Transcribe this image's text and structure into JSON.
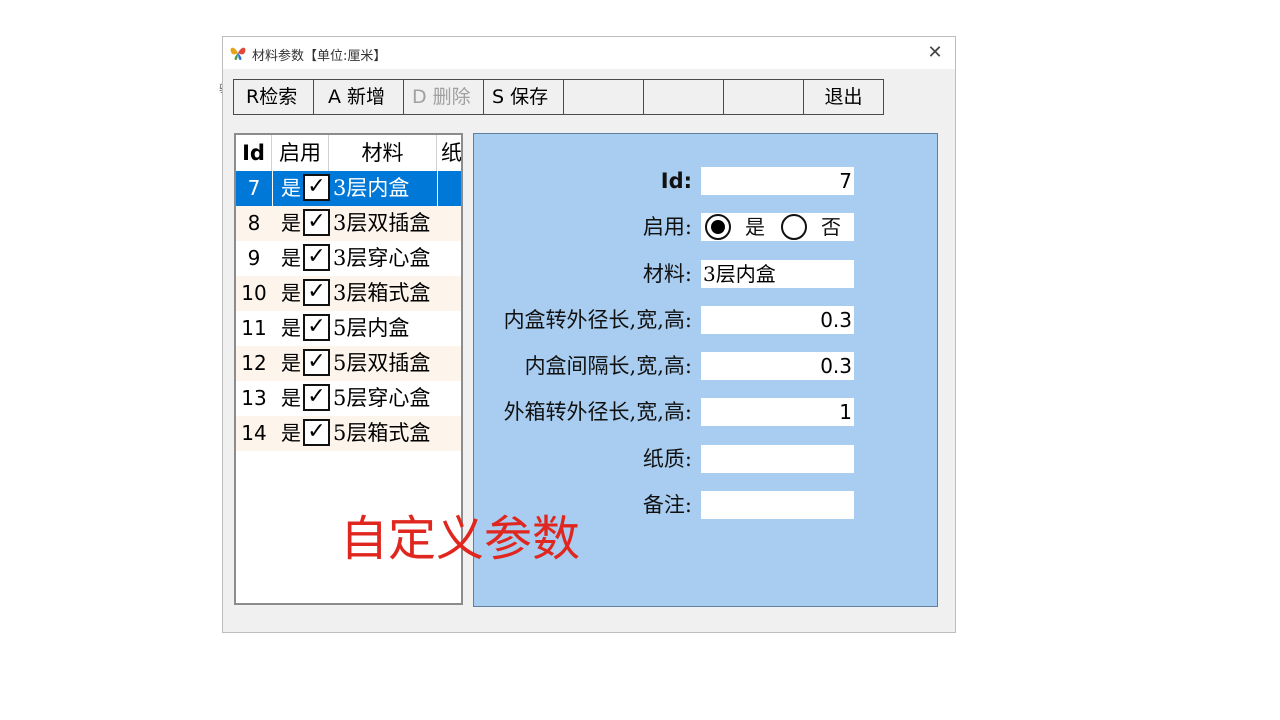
{
  "window": {
    "title": "材料参数【单位:厘米】",
    "close_glyph": "✕"
  },
  "toolbar": {
    "search": "R检索",
    "add": "A 新增",
    "delete": "D 删除",
    "save": "S 保存",
    "blank1": "",
    "blank2": "",
    "blank3": "",
    "exit": "退出"
  },
  "grid": {
    "columns": [
      "Id",
      "启用",
      "材料",
      "纸"
    ],
    "rows": [
      {
        "id": "7",
        "enabled_text": "是",
        "checked": true,
        "material": "3层内盒",
        "selected": true
      },
      {
        "id": "8",
        "enabled_text": "是",
        "checked": true,
        "material": "3层双插盒",
        "selected": false
      },
      {
        "id": "9",
        "enabled_text": "是",
        "checked": true,
        "material": "3层穿心盒",
        "selected": false
      },
      {
        "id": "10",
        "enabled_text": "是",
        "checked": true,
        "material": "3层箱式盒",
        "selected": false
      },
      {
        "id": "11",
        "enabled_text": "是",
        "checked": true,
        "material": "5层内盒",
        "selected": false
      },
      {
        "id": "12",
        "enabled_text": "是",
        "checked": true,
        "material": "5层双插盒",
        "selected": false
      },
      {
        "id": "13",
        "enabled_text": "是",
        "checked": true,
        "material": "5层穿心盒",
        "selected": false
      },
      {
        "id": "14",
        "enabled_text": "是",
        "checked": true,
        "material": "5层箱式盒",
        "selected": false
      }
    ],
    "check_glyph": "✓"
  },
  "form": {
    "id_label": "Id:",
    "id_value": "7",
    "enabled_label": "启用:",
    "enabled_yes": "是",
    "enabled_no": "否",
    "enabled_selected": "是",
    "material_label": "材料:",
    "material_value": "3层内盒",
    "inner_outer_label": "内盒转外径长,宽,高:",
    "inner_outer_value": "0.3",
    "inner_gap_label": "内盒间隔长,宽,高:",
    "inner_gap_value": "0.3",
    "outer_label": "外箱转外径长,宽,高:",
    "outer_value": "1",
    "paper_label": "纸质:",
    "paper_value": "",
    "remark_label": "备注:",
    "remark_value": ""
  },
  "overlay_caption": "自定义参数",
  "colors": {
    "selection": "#0078d7",
    "panel": "#a8cdf0",
    "caption": "#e0271f",
    "even_row": "#fdf5ec"
  },
  "icons": {
    "app": "butterfly-icon",
    "close": "close-icon",
    "checkbox": "check-icon"
  }
}
